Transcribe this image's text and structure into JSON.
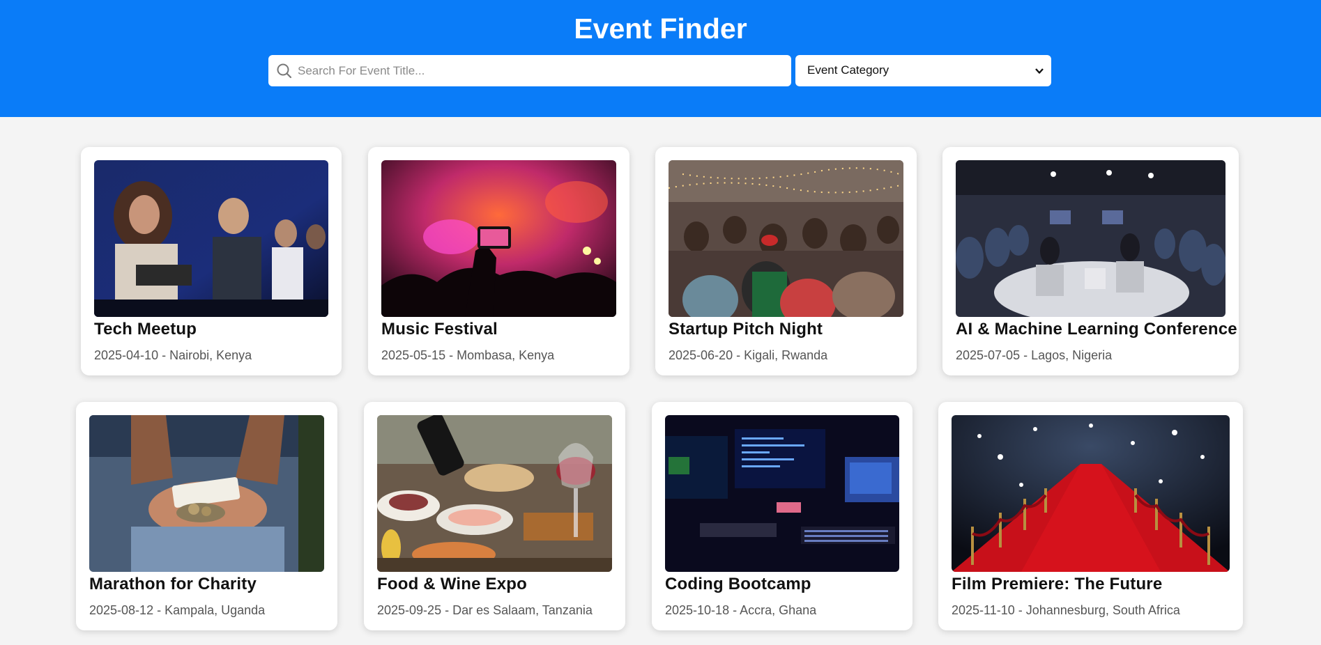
{
  "header": {
    "title": "Event Finder",
    "search_placeholder": "Search For Event Title...",
    "category_label": "Event Category"
  },
  "colors": {
    "header_bg": "#0a7cf8",
    "page_bg": "#f4f4f4"
  },
  "events": [
    {
      "title": "Tech Meetup",
      "meta": "2025-04-10 - Nairobi, Kenya"
    },
    {
      "title": "Music Festival",
      "meta": "2025-05-15 - Mombasa, Kenya"
    },
    {
      "title": "Startup Pitch Night",
      "meta": "2025-06-20 - Kigali, Rwanda"
    },
    {
      "title": "AI & Machine Learning Conference",
      "meta": "2025-07-05 - Lagos, Nigeria"
    },
    {
      "title": "Marathon for Charity",
      "meta": "2025-08-12 - Kampala, Uganda"
    },
    {
      "title": "Food & Wine Expo",
      "meta": "2025-09-25 - Dar es Salaam, Tanzania"
    },
    {
      "title": "Coding Bootcamp",
      "meta": "2025-10-18 - Accra, Ghana"
    },
    {
      "title": "Film Premiere: The Future",
      "meta": "2025-11-10 - Johannesburg, South Africa"
    }
  ]
}
